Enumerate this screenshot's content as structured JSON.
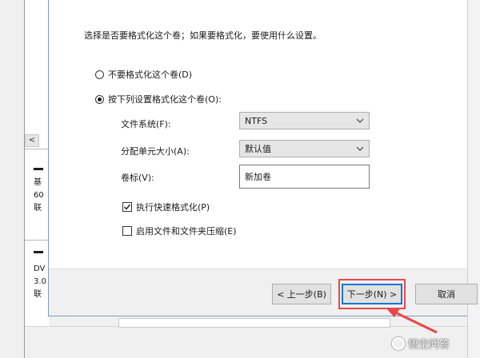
{
  "background": {
    "scroll_left": "<",
    "disk0_lines": [
      "基",
      "60",
      "联"
    ],
    "disk1_lines": [
      "DV",
      "3.0",
      "联"
    ]
  },
  "wizard": {
    "instruction": "选择是否要格式化这个卷；如果要格式化，要使用什么设置。",
    "options": {
      "no_format": {
        "label": "不要格式化这个卷(D)",
        "selected": false
      },
      "format": {
        "label": "按下列设置格式化这个卷(O):",
        "selected": true
      }
    },
    "fields": {
      "filesystem": {
        "label": "文件系统(F):",
        "value": "NTFS"
      },
      "allocation_unit": {
        "label": "分配单元大小(A):",
        "value": "默认值"
      },
      "volume_label": {
        "label": "卷标(V):",
        "value": "新加卷"
      }
    },
    "checkboxes": {
      "quick_format": {
        "label": "执行快速格式化(P)",
        "checked": true
      },
      "compression": {
        "label": "启用文件和文件夹压缩(E)",
        "checked": false
      }
    },
    "buttons": {
      "back": "< 上一步(B)",
      "next": "下一步(N) >",
      "cancel": "取消"
    }
  },
  "watermark": {
    "text": "悟空问答"
  },
  "colors": {
    "accent": "#0078d7",
    "annotation_red": "#e8474c"
  }
}
